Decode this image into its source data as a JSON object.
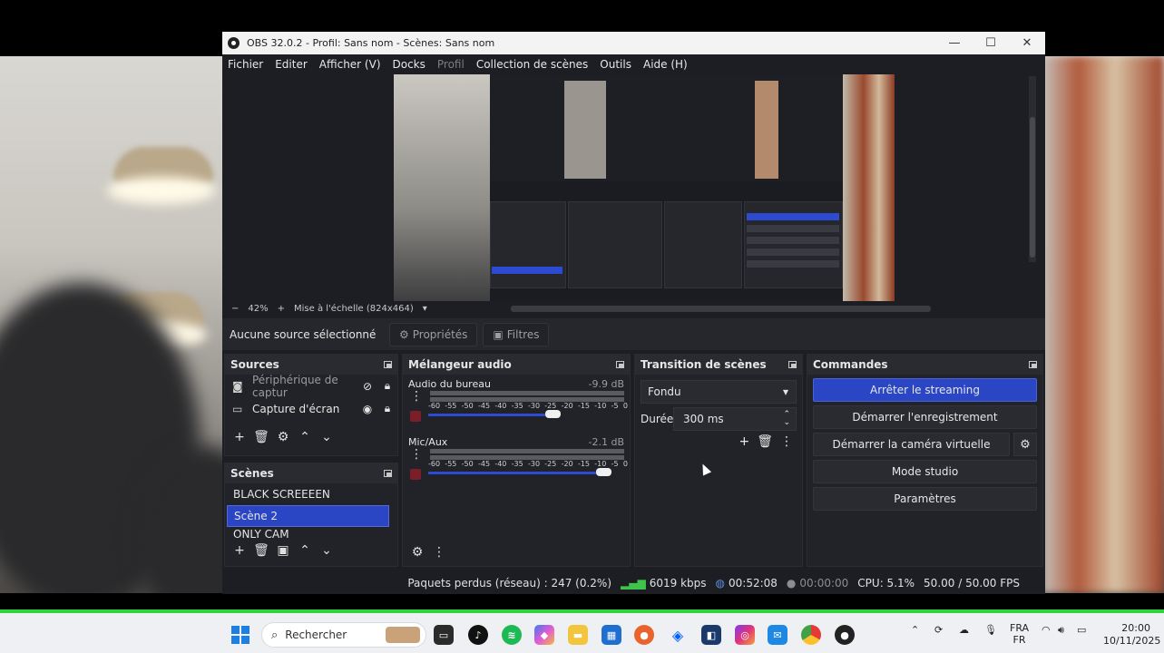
{
  "window": {
    "title": "OBS 32.0.2 - Profil: Sans nom - Scènes: Sans nom",
    "minimize": "—",
    "maximize": "☐",
    "close": "✕"
  },
  "menu": [
    "Fichier",
    "Editer",
    "Afficher (V)",
    "Docks",
    "Profil",
    "Collection de scènes",
    "Outils",
    "Aide (H)"
  ],
  "preview": {
    "zoom_minus": "−",
    "zoom": "42%",
    "zoom_plus": "+",
    "scale": "Mise à l'échelle (824x464)"
  },
  "context": {
    "no_selection": "Aucune source sélectionné",
    "properties": "Propriétés",
    "filters": "Filtres"
  },
  "sources": {
    "title": "Sources",
    "items": [
      {
        "name": "Périphérique de captur",
        "icon": "camera-icon"
      },
      {
        "name": "Capture d'écran",
        "icon": "monitor-icon"
      }
    ]
  },
  "scenes": {
    "title": "Scènes",
    "items": [
      "BLACK SCREEEEN",
      "Scène 2",
      "ONLY CAM"
    ],
    "selected": "Scène 2"
  },
  "mixer": {
    "title": "Mélangeur audio",
    "channels": [
      {
        "name": "Audio du bureau",
        "db": "-9.9 dB",
        "volume": 0.64
      },
      {
        "name": "Mic/Aux",
        "db": "-2.1 dB",
        "volume": 0.9
      }
    ],
    "scale": [
      "-60",
      "-55",
      "-50",
      "-45",
      "-40",
      "-35",
      "-30",
      "-25",
      "-20",
      "-15",
      "-10",
      "-5",
      "0"
    ]
  },
  "transitions": {
    "title": "Transition de scènes",
    "selected": "Fondu",
    "duration_label": "Durée",
    "duration_value": "300 ms"
  },
  "controls": {
    "title": "Commandes",
    "stop_streaming": "Arrêter le streaming",
    "start_recording": "Démarrer l'enregistrement",
    "start_virtualcam": "Démarrer la caméra virtuelle",
    "studio_mode": "Mode studio",
    "settings": "Paramètres"
  },
  "status": {
    "dropped_frames": "Paquets perdus (réseau) : 247 (0.2%)",
    "bitrate": "6019 kbps",
    "stream_time": "00:52:08",
    "record_time": "00:00:00",
    "cpu": "CPU: 5.1%",
    "fps": "50.00 / 50.00 FPS"
  },
  "taskbar": {
    "search_placeholder": "Rechercher",
    "lang_top": "FRA",
    "lang_bottom": "FR",
    "time": "20:00",
    "date": "10/11/2025"
  },
  "colors": {
    "accent": "#2b46c5",
    "panel": "#222328",
    "window_bg": "#1d1e23",
    "status_green": "#3ec44a"
  }
}
